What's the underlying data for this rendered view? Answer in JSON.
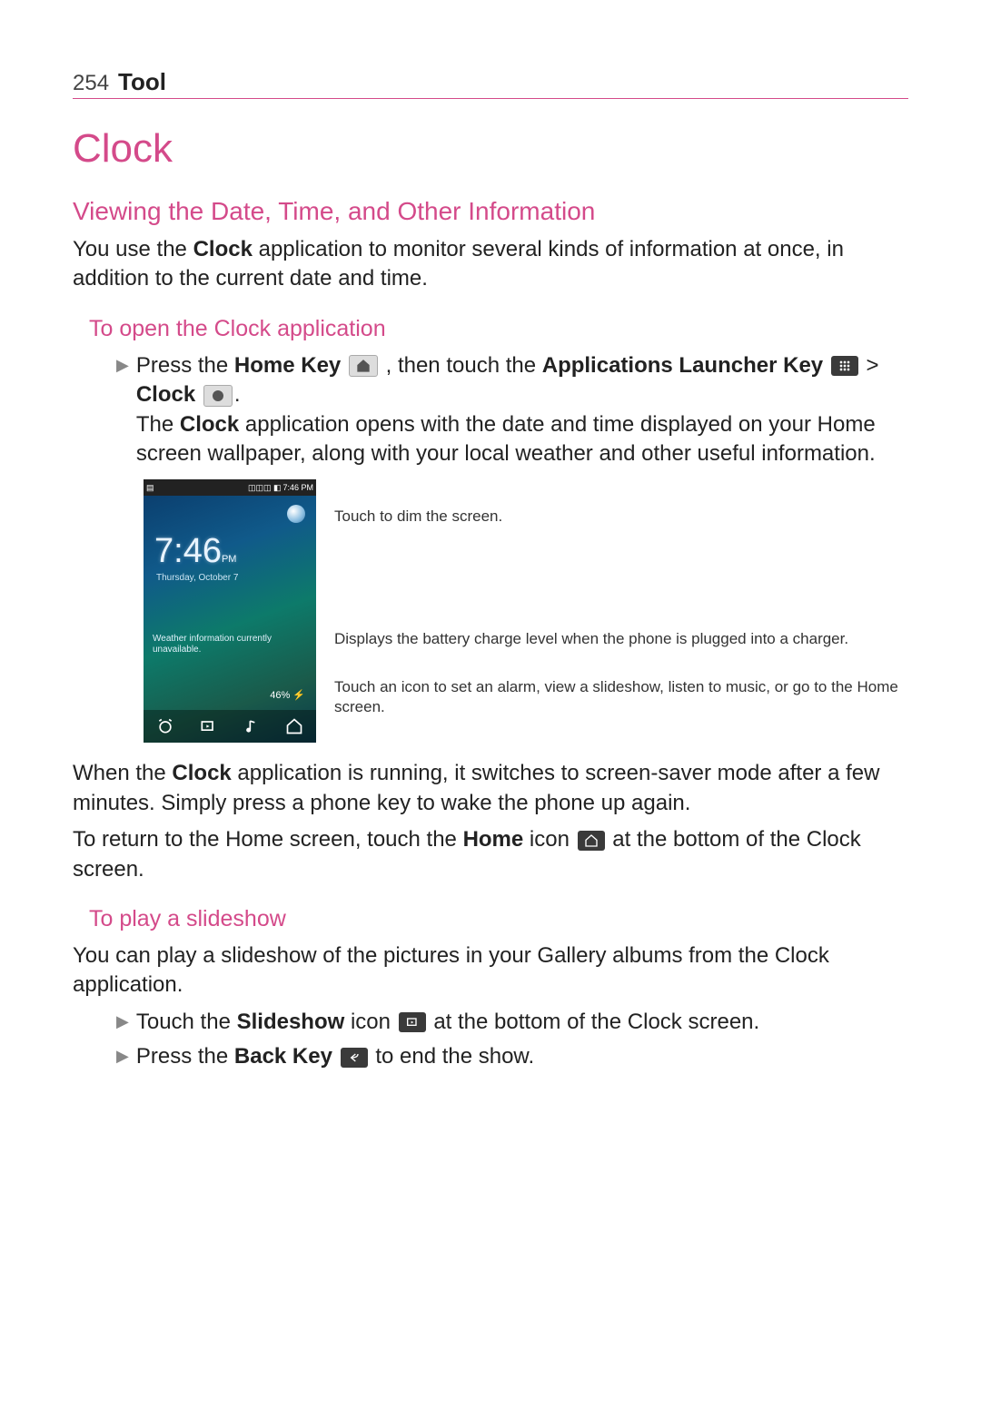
{
  "header": {
    "page_num": "254",
    "section": "Tool"
  },
  "title": "Clock",
  "s1": {
    "heading": "Viewing the Date, Time, and Other Information",
    "p1a": "You use the ",
    "p1b": "Clock",
    "p1c": " application to monitor several kinds of information at once, in addition to the current date and time."
  },
  "sub1": {
    "heading": "To open the Clock application",
    "b1a": "Press the ",
    "b1b": "Home Key ",
    "b1c": ", then touch the ",
    "b1d": "Applications Launcher Key ",
    "b1e": " > ",
    "b1f": "Clock ",
    "b1g": ".",
    "p2a": "The ",
    "p2b": "Clock",
    "p2c": " application opens with the date and time displayed on your Home screen wallpaper, along with your local weather and other useful information.",
    "callout1": "Touch to dim the screen.",
    "callout2": "Displays the battery charge level when the phone is plugged into a charger.",
    "callout3": "Touch an icon to set an alarm, view a slideshow, listen to music, or go to the Home screen.",
    "p3a": "When the ",
    "p3b": "Clock",
    "p3c": " application is running, it switches to screen-saver mode after a few minutes. Simply press a phone key to wake the phone up again.",
    "p4a": "To return to the Home screen, touch the ",
    "p4b": "Home",
    "p4c": " icon ",
    "p4d": " at the bottom of the Clock screen."
  },
  "phone": {
    "status_time": "7:46 PM",
    "time": "7:46",
    "pm": "PM",
    "date": "Thursday, October 7",
    "weather": "Weather information currently unavailable.",
    "battery": "46%"
  },
  "sub2": {
    "heading": "To play a slideshow",
    "p1": "You can play a slideshow of the pictures in your Gallery albums from the Clock application.",
    "b1a": "Touch the ",
    "b1b": "Slideshow",
    "b1c": " icon ",
    "b1d": " at the bottom of the Clock screen.",
    "b2a": "Press the ",
    "b2b": "Back Key ",
    "b2c": " to end the show."
  }
}
